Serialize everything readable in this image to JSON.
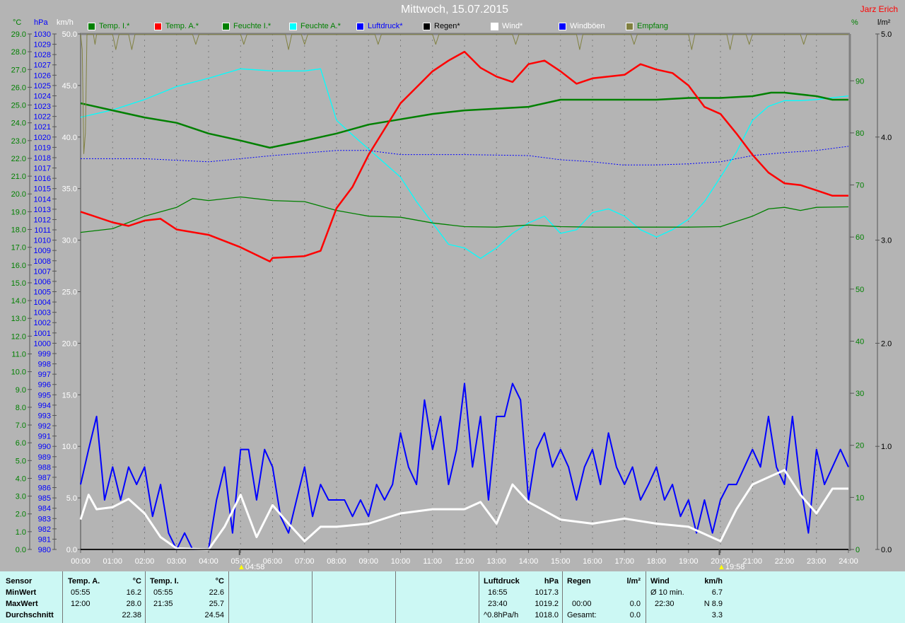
{
  "header": {
    "title": "Mittwoch, 15.07.2015",
    "author": "Jarz Erich"
  },
  "units": {
    "temp": "°C",
    "pressure": "hPa",
    "wind": "km/h",
    "humidity": "%",
    "rain": "l/m²"
  },
  "legend": [
    {
      "label": "Temp. I.*",
      "swatch": "#008000",
      "text_color": "#008000"
    },
    {
      "label": "Temp. A.*",
      "swatch": "#ff0000",
      "text_color": "#008000"
    },
    {
      "label": "Feuchte I.*",
      "swatch": "#008000",
      "text_color": "#008000"
    },
    {
      "label": "Feuchte A.*",
      "swatch": "#00ffff",
      "text_color": "#008000"
    },
    {
      "label": "Luftdruck*",
      "swatch": "#0000ff",
      "text_color": "#0000ff"
    },
    {
      "label": "Regen*",
      "swatch": "#000000",
      "text_color": "#000000"
    },
    {
      "label": "Wind*",
      "swatch": "#ffffff",
      "text_color": "#ffffff"
    },
    {
      "label": "Windböen",
      "swatch": "#0000ff",
      "text_color": "#ffffff"
    },
    {
      "label": "Empfang",
      "swatch": "#808040",
      "text_color": "#008000"
    }
  ],
  "markers": {
    "sunrise": "04:58",
    "sunset": "19:58",
    "sunrise_h": 4.967,
    "sunset_h": 19.967
  },
  "chart_data": {
    "type": "line",
    "title": "Mittwoch, 15.07.2015",
    "x_range_hours": [
      0,
      24
    ],
    "x_ticks": [
      "00:00",
      "01:00",
      "02:00",
      "03:00",
      "04:00",
      "05:00",
      "06:00",
      "07:00",
      "08:00",
      "09:00",
      "10:00",
      "11:00",
      "12:00",
      "13:00",
      "14:00",
      "15:00",
      "16:00",
      "17:00",
      "18:00",
      "19:00",
      "20:00",
      "21:00",
      "22:00",
      "23:00",
      "24:00"
    ],
    "axes": {
      "temp": {
        "min": 0,
        "max": 29,
        "step": 1,
        "decimals": 1,
        "color": "#008000"
      },
      "pressure": {
        "min": 980,
        "max": 1030,
        "step": 1,
        "decimals": 0,
        "color": "#0000ff"
      },
      "wind": {
        "min": 0,
        "max": 50,
        "step": 5,
        "decimals": 1,
        "color": "#ffffff"
      },
      "humidity": {
        "min": 0,
        "max": 99,
        "step": 10,
        "decimals": 0,
        "color": "#008000"
      },
      "rain": {
        "min": 0,
        "max": 5,
        "step": 1,
        "decimals": 1,
        "color": "#000000"
      }
    },
    "series": [
      {
        "name": "Feuchte A.",
        "axis": "humidity",
        "color": "#00ffff",
        "width": 1.3,
        "x": [
          0,
          1,
          2,
          3,
          4,
          5,
          6,
          7,
          7.5,
          8,
          8.5,
          9,
          9.5,
          10,
          10.5,
          11,
          11.5,
          12,
          12.5,
          13,
          13.5,
          14,
          14.5,
          15,
          15.5,
          16,
          16.5,
          17,
          17.5,
          18,
          18.5,
          19,
          19.5,
          20,
          20.5,
          21,
          21.5,
          22,
          22.5,
          23,
          24
        ],
        "y": [
          83.0,
          84.4,
          86.4,
          88.9,
          90.5,
          92.3,
          91.9,
          91.9,
          92.3,
          82.4,
          79.6,
          76.9,
          74.2,
          71.5,
          66.8,
          62.7,
          58.6,
          57.9,
          55.9,
          57.9,
          60.7,
          62.7,
          64.0,
          60.7,
          61.4,
          64.7,
          65.4,
          64.0,
          61.4,
          60.0,
          61.4,
          63.4,
          66.8,
          71.5,
          76.3,
          82.4,
          85.1,
          86.2,
          86.2,
          86.4,
          87.1
        ]
      },
      {
        "name": "Feuchte I.",
        "axis": "humidity",
        "color": "#008000",
        "width": 1.3,
        "x": [
          0,
          1,
          2,
          3,
          3.5,
          4,
          5,
          6,
          7,
          8,
          9,
          10,
          11,
          12,
          13,
          14,
          15,
          16,
          17,
          18,
          19,
          20,
          21,
          21.5,
          22,
          22.5,
          23,
          24
        ],
        "y": [
          60.9,
          61.6,
          64.0,
          65.7,
          67.4,
          67.0,
          67.7,
          67.0,
          66.8,
          65.1,
          64.0,
          63.8,
          62.7,
          62.0,
          61.9,
          62.3,
          62.0,
          61.9,
          61.9,
          61.9,
          61.9,
          62.0,
          64.0,
          65.4,
          65.7,
          65.1,
          65.7,
          65.8
        ]
      },
      {
        "name": "Luftdruck",
        "axis": "pressure",
        "color": "#0000ff",
        "width": 1,
        "dashed": true,
        "x": [
          0,
          2,
          4,
          5,
          6,
          8,
          9,
          10,
          12,
          14,
          15,
          16,
          16.917,
          18,
          19,
          20,
          21,
          22,
          23,
          24
        ],
        "y": [
          1017.9,
          1017.9,
          1017.6,
          1017.9,
          1018.2,
          1018.7,
          1018.7,
          1018.3,
          1018.3,
          1018.2,
          1017.8,
          1017.6,
          1017.3,
          1017.3,
          1017.4,
          1017.6,
          1018.2,
          1018.5,
          1018.7,
          1019.1
        ]
      },
      {
        "name": "Regen",
        "axis": "rain",
        "color": "#000000",
        "width": 1.5,
        "x": [
          0,
          24
        ],
        "y": [
          0,
          0
        ]
      },
      {
        "name": "Windböen",
        "axis": "wind",
        "color": "#0000ff",
        "width": 2,
        "x": [
          0,
          0.25,
          0.5,
          0.75,
          1,
          1.25,
          1.5,
          1.75,
          2,
          2.25,
          2.5,
          2.75,
          3,
          3.25,
          3.5,
          3.75,
          4,
          4.25,
          4.5,
          4.75,
          5,
          5.25,
          5.5,
          5.75,
          6,
          6.25,
          6.5,
          6.75,
          7,
          7.25,
          7.5,
          7.75,
          8,
          8.25,
          8.5,
          8.75,
          9,
          9.25,
          9.5,
          9.75,
          10,
          10.25,
          10.5,
          10.75,
          11,
          11.25,
          11.5,
          11.75,
          12,
          12.25,
          12.5,
          12.75,
          13,
          13.25,
          13.5,
          13.75,
          14,
          14.25,
          14.5,
          14.75,
          15,
          15.25,
          15.5,
          15.75,
          16,
          16.25,
          16.5,
          16.75,
          17,
          17.25,
          17.5,
          17.75,
          18,
          18.25,
          18.5,
          18.75,
          19,
          19.25,
          19.5,
          19.75,
          20,
          20.25,
          20.5,
          20.75,
          21,
          21.25,
          21.5,
          21.75,
          22,
          22.25,
          22.5,
          22.75,
          23,
          23.25,
          23.5,
          23.75,
          24
        ],
        "y": [
          6.3,
          9.7,
          12.9,
          4.8,
          8.0,
          4.8,
          8.0,
          6.3,
          8.0,
          3.2,
          6.3,
          1.6,
          0,
          1.6,
          0,
          0,
          0,
          4.8,
          8.0,
          1.6,
          9.7,
          9.7,
          4.8,
          9.7,
          8.0,
          3.2,
          1.6,
          4.8,
          8.0,
          3.2,
          6.3,
          4.8,
          4.8,
          4.8,
          3.2,
          4.8,
          3.2,
          6.3,
          4.8,
          6.3,
          11.3,
          8.0,
          6.3,
          14.5,
          9.7,
          12.9,
          6.3,
          9.7,
          16.1,
          8.0,
          12.9,
          4.8,
          12.9,
          12.9,
          16.1,
          14.5,
          4.8,
          9.7,
          11.3,
          8.0,
          9.7,
          8.0,
          4.8,
          8.0,
          9.7,
          6.3,
          11.3,
          8.0,
          6.3,
          8.0,
          4.8,
          6.3,
          8.0,
          4.8,
          6.3,
          3.2,
          4.8,
          1.6,
          4.8,
          1.6,
          4.8,
          6.3,
          6.3,
          8.0,
          9.7,
          8.0,
          12.9,
          8.0,
          6.3,
          12.9,
          6.3,
          1.6,
          9.7,
          6.3,
          8.0,
          9.7,
          8.0
        ]
      },
      {
        "name": "Wind",
        "axis": "wind",
        "color": "#ffffff",
        "width": 3,
        "x": [
          0,
          0.25,
          0.5,
          1,
          1.5,
          2,
          2.5,
          3,
          4,
          4.5,
          5,
          5.5,
          6,
          6.5,
          7,
          7.5,
          8,
          9,
          10,
          11,
          12,
          12.5,
          13,
          13.5,
          14,
          15,
          16,
          17,
          18,
          19,
          20,
          20.5,
          21,
          21.5,
          22,
          22.5,
          23,
          23.5,
          24
        ],
        "y": [
          2.9,
          5.3,
          3.9,
          4.1,
          4.9,
          3.5,
          1.2,
          0.1,
          0,
          2.2,
          5.3,
          1.2,
          4.3,
          2.5,
          0.8,
          2.2,
          2.2,
          2.5,
          3.5,
          3.9,
          3.9,
          4.6,
          2.5,
          6.3,
          4.6,
          2.9,
          2.5,
          3.0,
          2.5,
          2.2,
          0.8,
          3.9,
          6.3,
          7.0,
          7.7,
          5.3,
          3.5,
          5.9,
          5.9
        ]
      },
      {
        "name": "Temp. I.",
        "axis": "temp",
        "color": "#008000",
        "width": 2.5,
        "x": [
          0,
          1,
          2,
          3,
          4,
          5,
          5.917,
          7,
          8,
          9,
          10,
          11,
          12,
          13,
          14,
          15,
          16,
          17,
          18,
          19,
          20,
          21,
          21.583,
          22,
          23,
          23.5,
          24
        ],
        "y": [
          25.1,
          24.7,
          24.3,
          24.0,
          23.4,
          23.0,
          22.6,
          23.0,
          23.4,
          23.9,
          24.2,
          24.5,
          24.7,
          24.8,
          24.9,
          25.3,
          25.3,
          25.3,
          25.3,
          25.4,
          25.4,
          25.5,
          25.7,
          25.7,
          25.5,
          25.3,
          25.3
        ]
      },
      {
        "name": "Temp. A.",
        "axis": "temp",
        "color": "#ff0000",
        "width": 2.5,
        "x": [
          0,
          1,
          1.5,
          2,
          2.5,
          3,
          4,
          5,
          5.917,
          6,
          7,
          7.5,
          8,
          8.5,
          9,
          10,
          11,
          11.5,
          12,
          12.5,
          13,
          13.5,
          14,
          14.5,
          15,
          15.5,
          16,
          16.5,
          17,
          17.5,
          18,
          18.5,
          19,
          19.5,
          20,
          20.5,
          21,
          21.5,
          22,
          22.5,
          23,
          23.5,
          24
        ],
        "y": [
          19.0,
          18.4,
          18.2,
          18.5,
          18.6,
          18.0,
          17.7,
          17.0,
          16.2,
          16.4,
          16.5,
          16.8,
          19.2,
          20.4,
          22.2,
          25.1,
          26.9,
          27.5,
          28.0,
          27.1,
          26.6,
          26.3,
          27.3,
          27.5,
          26.9,
          26.2,
          26.5,
          26.6,
          26.7,
          27.3,
          27.0,
          26.8,
          26.1,
          24.9,
          24.5,
          23.4,
          22.2,
          21.2,
          20.6,
          20.5,
          20.2,
          19.9,
          19.9
        ]
      },
      {
        "name": "Empfang",
        "axis": "humidity",
        "color": "#808040",
        "width": 1,
        "x": [
          0,
          0.05,
          0.1,
          0.15,
          0.2,
          0.4,
          0.45,
          0.5,
          1.0,
          1.1,
          1.2,
          1.5,
          1.6,
          1.7,
          3.5,
          3.6,
          3.7,
          5.0,
          5.1,
          5.2,
          6.4,
          6.5,
          6.6,
          6.9,
          7.0,
          7.1,
          9.2,
          9.3,
          9.4,
          11.0,
          11.1,
          11.2,
          13.5,
          13.6,
          13.7,
          15.5,
          15.6,
          15.7,
          17.2,
          17.3,
          17.4,
          19.0,
          19.1,
          19.2,
          20.2,
          20.3,
          20.4,
          20.8,
          20.9,
          21.0,
          22.5,
          22.6,
          22.7,
          24
        ],
        "y": [
          98.9,
          96,
          76,
          80,
          98.9,
          98.9,
          97,
          98.9,
          98.9,
          96,
          98.9,
          98.9,
          96,
          98.9,
          98.9,
          97,
          98.9,
          98.9,
          97,
          98.9,
          98.9,
          96,
          98.9,
          98.9,
          97,
          98.9,
          98.9,
          97,
          98.9,
          98.9,
          97,
          98.9,
          98.9,
          97,
          98.9,
          98.9,
          96,
          98.9,
          98.9,
          97,
          98.9,
          98.9,
          96,
          98.9,
          98.9,
          96,
          98.9,
          98.9,
          97,
          98.9,
          98.9,
          97,
          98.9,
          98.9
        ]
      }
    ]
  },
  "table": {
    "sensor": {
      "header": "Sensor",
      "rows": [
        "MinWert",
        "MaxWert",
        "Durchschnitt"
      ]
    },
    "temp_a": {
      "header": "Temp. A.",
      "unit": "°C",
      "min_time": "05:55",
      "min": "16.2",
      "max_time": "12:00",
      "max": "28.0",
      "avg": "22.38"
    },
    "temp_i": {
      "header": "Temp. I.",
      "unit": "°C",
      "min_time": "05:55",
      "min": "22.6",
      "max_time": "21:35",
      "max": "25.7",
      "avg": "24.54"
    },
    "pressure": {
      "header": "Luftdruck",
      "unit": "hPa",
      "min_time": "16:55",
      "min": "1017.3",
      "max_time": "23:40",
      "max": "1019.2",
      "trend": "^0.8hPa/h",
      "avg": "1018.0"
    },
    "rain": {
      "header": "Regen",
      "unit": "l/m²",
      "time": "00:00",
      "value": "0.0",
      "total_label": "Gesamt:",
      "total": "0.0"
    },
    "wind": {
      "header": "Wind",
      "unit": "km/h",
      "avg_label": "Ø 10 min.",
      "avg": "6.7",
      "max_time": "22:30",
      "max": "N 8.9",
      "day_avg": "3.3"
    }
  }
}
